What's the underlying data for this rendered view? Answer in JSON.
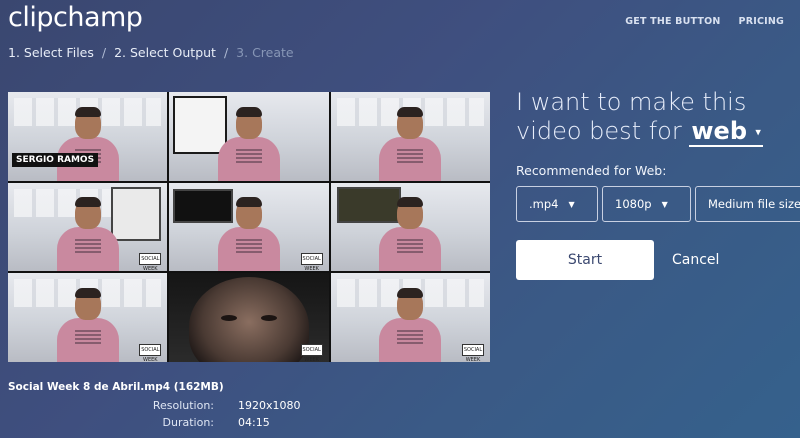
{
  "brand": {
    "logo_text": "clipchamp"
  },
  "nav": {
    "items": [
      "GET THE BUTTON",
      "PRICING"
    ]
  },
  "breadcrumb": {
    "steps": [
      "1. Select Files",
      "2. Select Output",
      "3. Create"
    ],
    "separator": "/"
  },
  "preview": {
    "name_tag": "SERGIO RAMOS",
    "stamp_text": "SOCIAL WEEK"
  },
  "output": {
    "headline_line1": "I want to make this",
    "headline_prefix": "video best for",
    "target": "web",
    "recommended_label": "Recommended for Web:",
    "format": ".mp4",
    "resolution": "1080p",
    "quality": "Medium file size",
    "start_label": "Start",
    "cancel_label": "Cancel"
  },
  "file": {
    "name": "Social Week 8 de Abril.mp4 (162MB)",
    "resolution_label": "Resolution:",
    "resolution_value": "1920x1080",
    "duration_label": "Duration:",
    "duration_value": "04:15"
  },
  "colors": {
    "bg_start": "#3a4770",
    "bg_end": "#35618c",
    "accent": "#ffffff",
    "start_text": "#3b4870"
  },
  "icons": {
    "caret": "chevron-down-icon"
  }
}
